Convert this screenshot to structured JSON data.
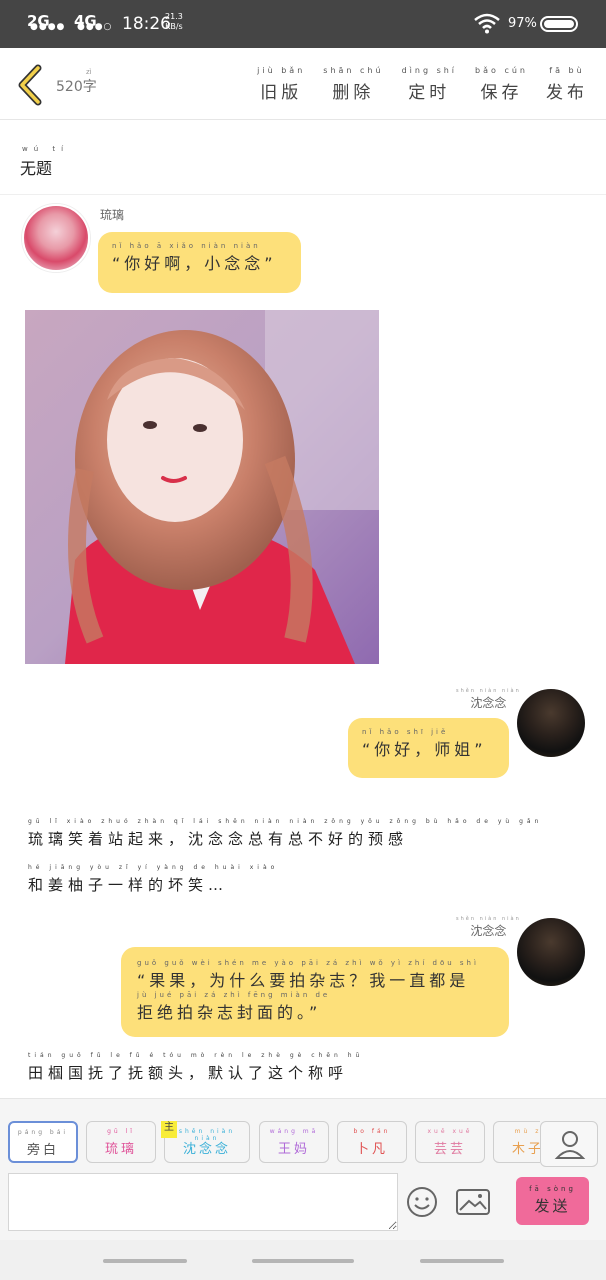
{
  "status_bar": {
    "signal1": "2G",
    "signal2": "4G",
    "time": "18:26",
    "speed_value": "21.3",
    "speed_unit": "KB/s",
    "battery": "97%"
  },
  "header": {
    "word_count": "520字",
    "word_count_pinyin": "zì",
    "actions": [
      {
        "pinyin": "jiù  bǎn",
        "label": "旧版"
      },
      {
        "pinyin": "shān  chú",
        "label": "删除"
      },
      {
        "pinyin": "dìng  shí",
        "label": "定时"
      },
      {
        "pinyin": "bǎo  cún",
        "label": "保存"
      },
      {
        "pinyin": "fā  bù",
        "label": "发布"
      }
    ]
  },
  "story": {
    "title_pinyin": "wú  tí",
    "title": "无题"
  },
  "messages": {
    "m1_speaker": "琉璃",
    "m1_pinyin": "nǐ   hǎo   ā    xiǎo niàn niàn",
    "m1_text": "“你好啊，小念念”",
    "m2_speaker_pinyin": "shěn  niàn  niàn",
    "m2_speaker": "沈念念",
    "m2_pinyin": "nǐ   hǎo    shī  jiě",
    "m2_text": "“你好，师姐”",
    "m3_speaker_pinyin": "shěn  niàn  niàn",
    "m3_speaker": "沈念念",
    "m3_line1_pinyin": "guǒ guǒ  wèi shén me  yào pāi zá  zhì     wǒ  yì  zhí dōu shì",
    "m3_line1": "“果果，为什么要拍杂志？我一直都是",
    "m3_line2_pinyin": "jù  jué  pāi  zá  zhì fēng miàn de",
    "m3_line2": "拒绝拍杂志封面的。”"
  },
  "narration": {
    "n1_line1_pinyin": "gū  lǐ  xiào zhuó zhàn  qǐ  lái    shěn niàn niàn zǒng yǒu zǒng  bù  hǎo  de  yù  gǎn",
    "n1_line1": "琉璃笑着站起来，沈念念总有总不好的预感",
    "n1_line2_pinyin": "hé  jiāng yòu  zǐ  yí  yàng  de  huài xiào",
    "n1_line2": "和姜柚子一样的坏笑…",
    "n2_pinyin": "tián    guō  fǔ  le   fǔ   é   tóu    mò  rèn  le  zhè  gè  chēn  hū",
    "n2_text": "田椢国抚了抚额头，默认了这个称呼"
  },
  "roles": [
    {
      "pinyin": "páng bái",
      "label": "旁白",
      "color": "#555555"
    },
    {
      "pinyin": "gū  lǐ",
      "label": "琉璃",
      "color": "#e0559a"
    },
    {
      "pinyin": "shěn niàn niàn",
      "label": "沈念念",
      "color": "#3ab0d8",
      "tag": "主"
    },
    {
      "pinyin": "wáng mā",
      "label": "王妈",
      "color": "#b06ad8"
    },
    {
      "pinyin": "bo  fán",
      "label": "卜凡",
      "color": "#e05050"
    },
    {
      "pinyin": "xuě  xuě",
      "label": "芸芸",
      "color": "#e07aa0"
    },
    {
      "pinyin": "mù  z",
      "label": "木子",
      "color": "#e8a050"
    }
  ],
  "composer": {
    "input_value": "",
    "send_pinyin": "fā  sòng",
    "send_label": "发送"
  },
  "colors": {
    "bubble": "#fde07a",
    "send_button": "#f06a9a",
    "status_bar": "#454545"
  }
}
